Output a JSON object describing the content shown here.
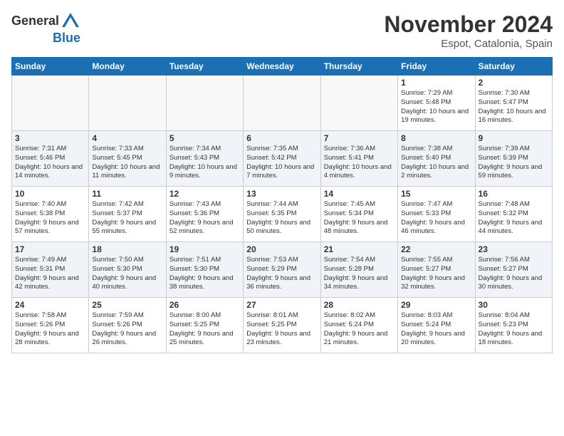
{
  "header": {
    "logo_general": "General",
    "logo_blue": "Blue",
    "month_title": "November 2024",
    "location": "Espot, Catalonia, Spain"
  },
  "days_of_week": [
    "Sunday",
    "Monday",
    "Tuesday",
    "Wednesday",
    "Thursday",
    "Friday",
    "Saturday"
  ],
  "weeks": [
    [
      {
        "day": "",
        "info": ""
      },
      {
        "day": "",
        "info": ""
      },
      {
        "day": "",
        "info": ""
      },
      {
        "day": "",
        "info": ""
      },
      {
        "day": "",
        "info": ""
      },
      {
        "day": "1",
        "info": "Sunrise: 7:29 AM\nSunset: 5:48 PM\nDaylight: 10 hours and 19 minutes."
      },
      {
        "day": "2",
        "info": "Sunrise: 7:30 AM\nSunset: 5:47 PM\nDaylight: 10 hours and 16 minutes."
      }
    ],
    [
      {
        "day": "3",
        "info": "Sunrise: 7:31 AM\nSunset: 5:46 PM\nDaylight: 10 hours and 14 minutes."
      },
      {
        "day": "4",
        "info": "Sunrise: 7:33 AM\nSunset: 5:45 PM\nDaylight: 10 hours and 11 minutes."
      },
      {
        "day": "5",
        "info": "Sunrise: 7:34 AM\nSunset: 5:43 PM\nDaylight: 10 hours and 9 minutes."
      },
      {
        "day": "6",
        "info": "Sunrise: 7:35 AM\nSunset: 5:42 PM\nDaylight: 10 hours and 7 minutes."
      },
      {
        "day": "7",
        "info": "Sunrise: 7:36 AM\nSunset: 5:41 PM\nDaylight: 10 hours and 4 minutes."
      },
      {
        "day": "8",
        "info": "Sunrise: 7:38 AM\nSunset: 5:40 PM\nDaylight: 10 hours and 2 minutes."
      },
      {
        "day": "9",
        "info": "Sunrise: 7:39 AM\nSunset: 5:39 PM\nDaylight: 9 hours and 59 minutes."
      }
    ],
    [
      {
        "day": "10",
        "info": "Sunrise: 7:40 AM\nSunset: 5:38 PM\nDaylight: 9 hours and 57 minutes."
      },
      {
        "day": "11",
        "info": "Sunrise: 7:42 AM\nSunset: 5:37 PM\nDaylight: 9 hours and 55 minutes."
      },
      {
        "day": "12",
        "info": "Sunrise: 7:43 AM\nSunset: 5:36 PM\nDaylight: 9 hours and 52 minutes."
      },
      {
        "day": "13",
        "info": "Sunrise: 7:44 AM\nSunset: 5:35 PM\nDaylight: 9 hours and 50 minutes."
      },
      {
        "day": "14",
        "info": "Sunrise: 7:45 AM\nSunset: 5:34 PM\nDaylight: 9 hours and 48 minutes."
      },
      {
        "day": "15",
        "info": "Sunrise: 7:47 AM\nSunset: 5:33 PM\nDaylight: 9 hours and 46 minutes."
      },
      {
        "day": "16",
        "info": "Sunrise: 7:48 AM\nSunset: 5:32 PM\nDaylight: 9 hours and 44 minutes."
      }
    ],
    [
      {
        "day": "17",
        "info": "Sunrise: 7:49 AM\nSunset: 5:31 PM\nDaylight: 9 hours and 42 minutes."
      },
      {
        "day": "18",
        "info": "Sunrise: 7:50 AM\nSunset: 5:30 PM\nDaylight: 9 hours and 40 minutes."
      },
      {
        "day": "19",
        "info": "Sunrise: 7:51 AM\nSunset: 5:30 PM\nDaylight: 9 hours and 38 minutes."
      },
      {
        "day": "20",
        "info": "Sunrise: 7:53 AM\nSunset: 5:29 PM\nDaylight: 9 hours and 36 minutes."
      },
      {
        "day": "21",
        "info": "Sunrise: 7:54 AM\nSunset: 5:28 PM\nDaylight: 9 hours and 34 minutes."
      },
      {
        "day": "22",
        "info": "Sunrise: 7:55 AM\nSunset: 5:27 PM\nDaylight: 9 hours and 32 minutes."
      },
      {
        "day": "23",
        "info": "Sunrise: 7:56 AM\nSunset: 5:27 PM\nDaylight: 9 hours and 30 minutes."
      }
    ],
    [
      {
        "day": "24",
        "info": "Sunrise: 7:58 AM\nSunset: 5:26 PM\nDaylight: 9 hours and 28 minutes."
      },
      {
        "day": "25",
        "info": "Sunrise: 7:59 AM\nSunset: 5:26 PM\nDaylight: 9 hours and 26 minutes."
      },
      {
        "day": "26",
        "info": "Sunrise: 8:00 AM\nSunset: 5:25 PM\nDaylight: 9 hours and 25 minutes."
      },
      {
        "day": "27",
        "info": "Sunrise: 8:01 AM\nSunset: 5:25 PM\nDaylight: 9 hours and 23 minutes."
      },
      {
        "day": "28",
        "info": "Sunrise: 8:02 AM\nSunset: 5:24 PM\nDaylight: 9 hours and 21 minutes."
      },
      {
        "day": "29",
        "info": "Sunrise: 8:03 AM\nSunset: 5:24 PM\nDaylight: 9 hours and 20 minutes."
      },
      {
        "day": "30",
        "info": "Sunrise: 8:04 AM\nSunset: 5:23 PM\nDaylight: 9 hours and 18 minutes."
      }
    ]
  ]
}
